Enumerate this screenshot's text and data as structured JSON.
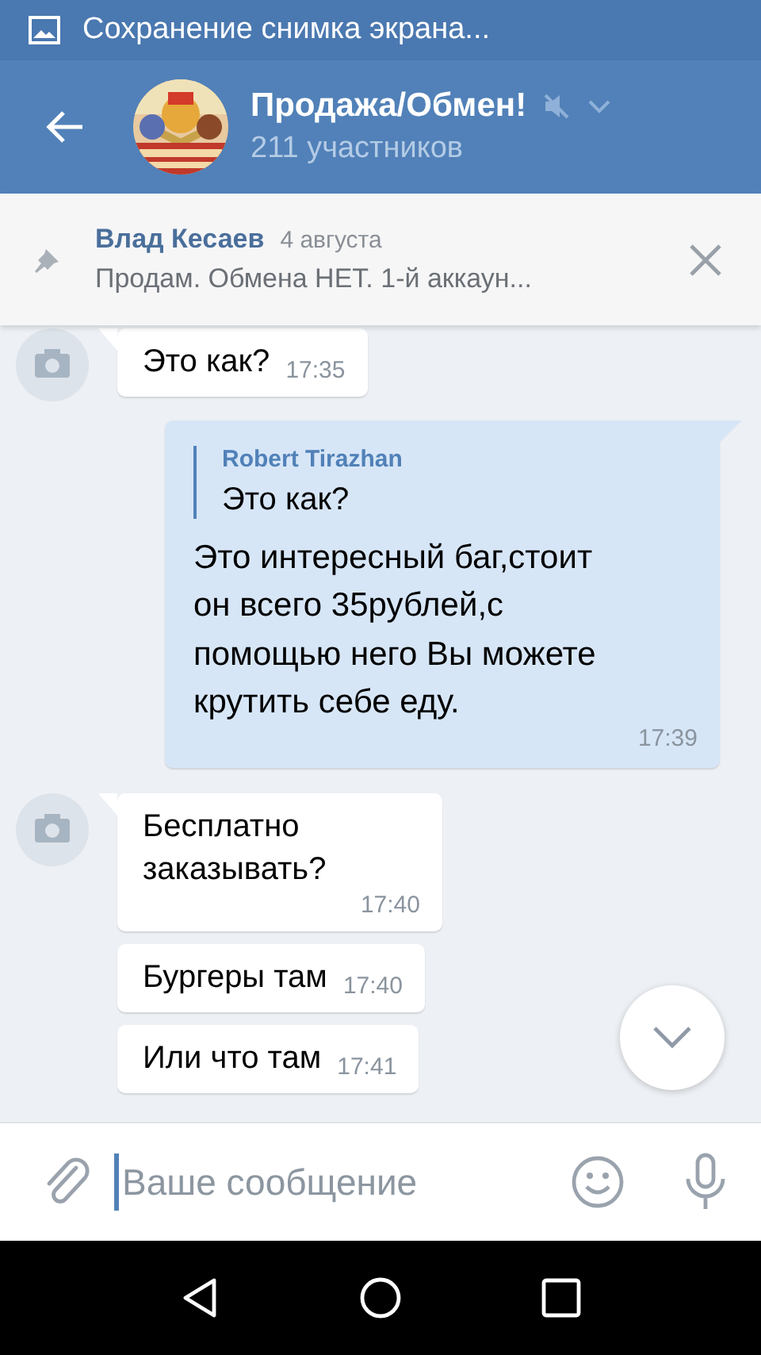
{
  "status_bar": {
    "notification": "Сохранение снимка экрана..."
  },
  "header": {
    "title": "Продажа/Обмен!",
    "subtitle": "211 участников",
    "muted": true
  },
  "pinned": {
    "author": "Влад Кесаев",
    "date": "4 августа",
    "text": "Продам. Обмена НЕТ.  1-й аккаун..."
  },
  "messages": [
    {
      "kind": "incoming",
      "avatar": true,
      "text": "Это как?",
      "time": "17:35"
    },
    {
      "kind": "outgoing",
      "reply": {
        "author": "Robert Tirazhan",
        "text": "Это как?"
      },
      "text": "Это интересный баг,стоит он всего 35рублей,с помощью него Вы можете крутить себе еду.",
      "time": "17:39"
    },
    {
      "kind": "incoming",
      "avatar": true,
      "text": "Бесплатно заказывать?",
      "time": "17:40"
    },
    {
      "kind": "incoming",
      "avatar": false,
      "text": "Бургеры там",
      "time": "17:40"
    },
    {
      "kind": "incoming",
      "avatar": false,
      "text": "Или что там",
      "time": "17:41"
    }
  ],
  "composer": {
    "placeholder": "Ваше сообщение"
  }
}
